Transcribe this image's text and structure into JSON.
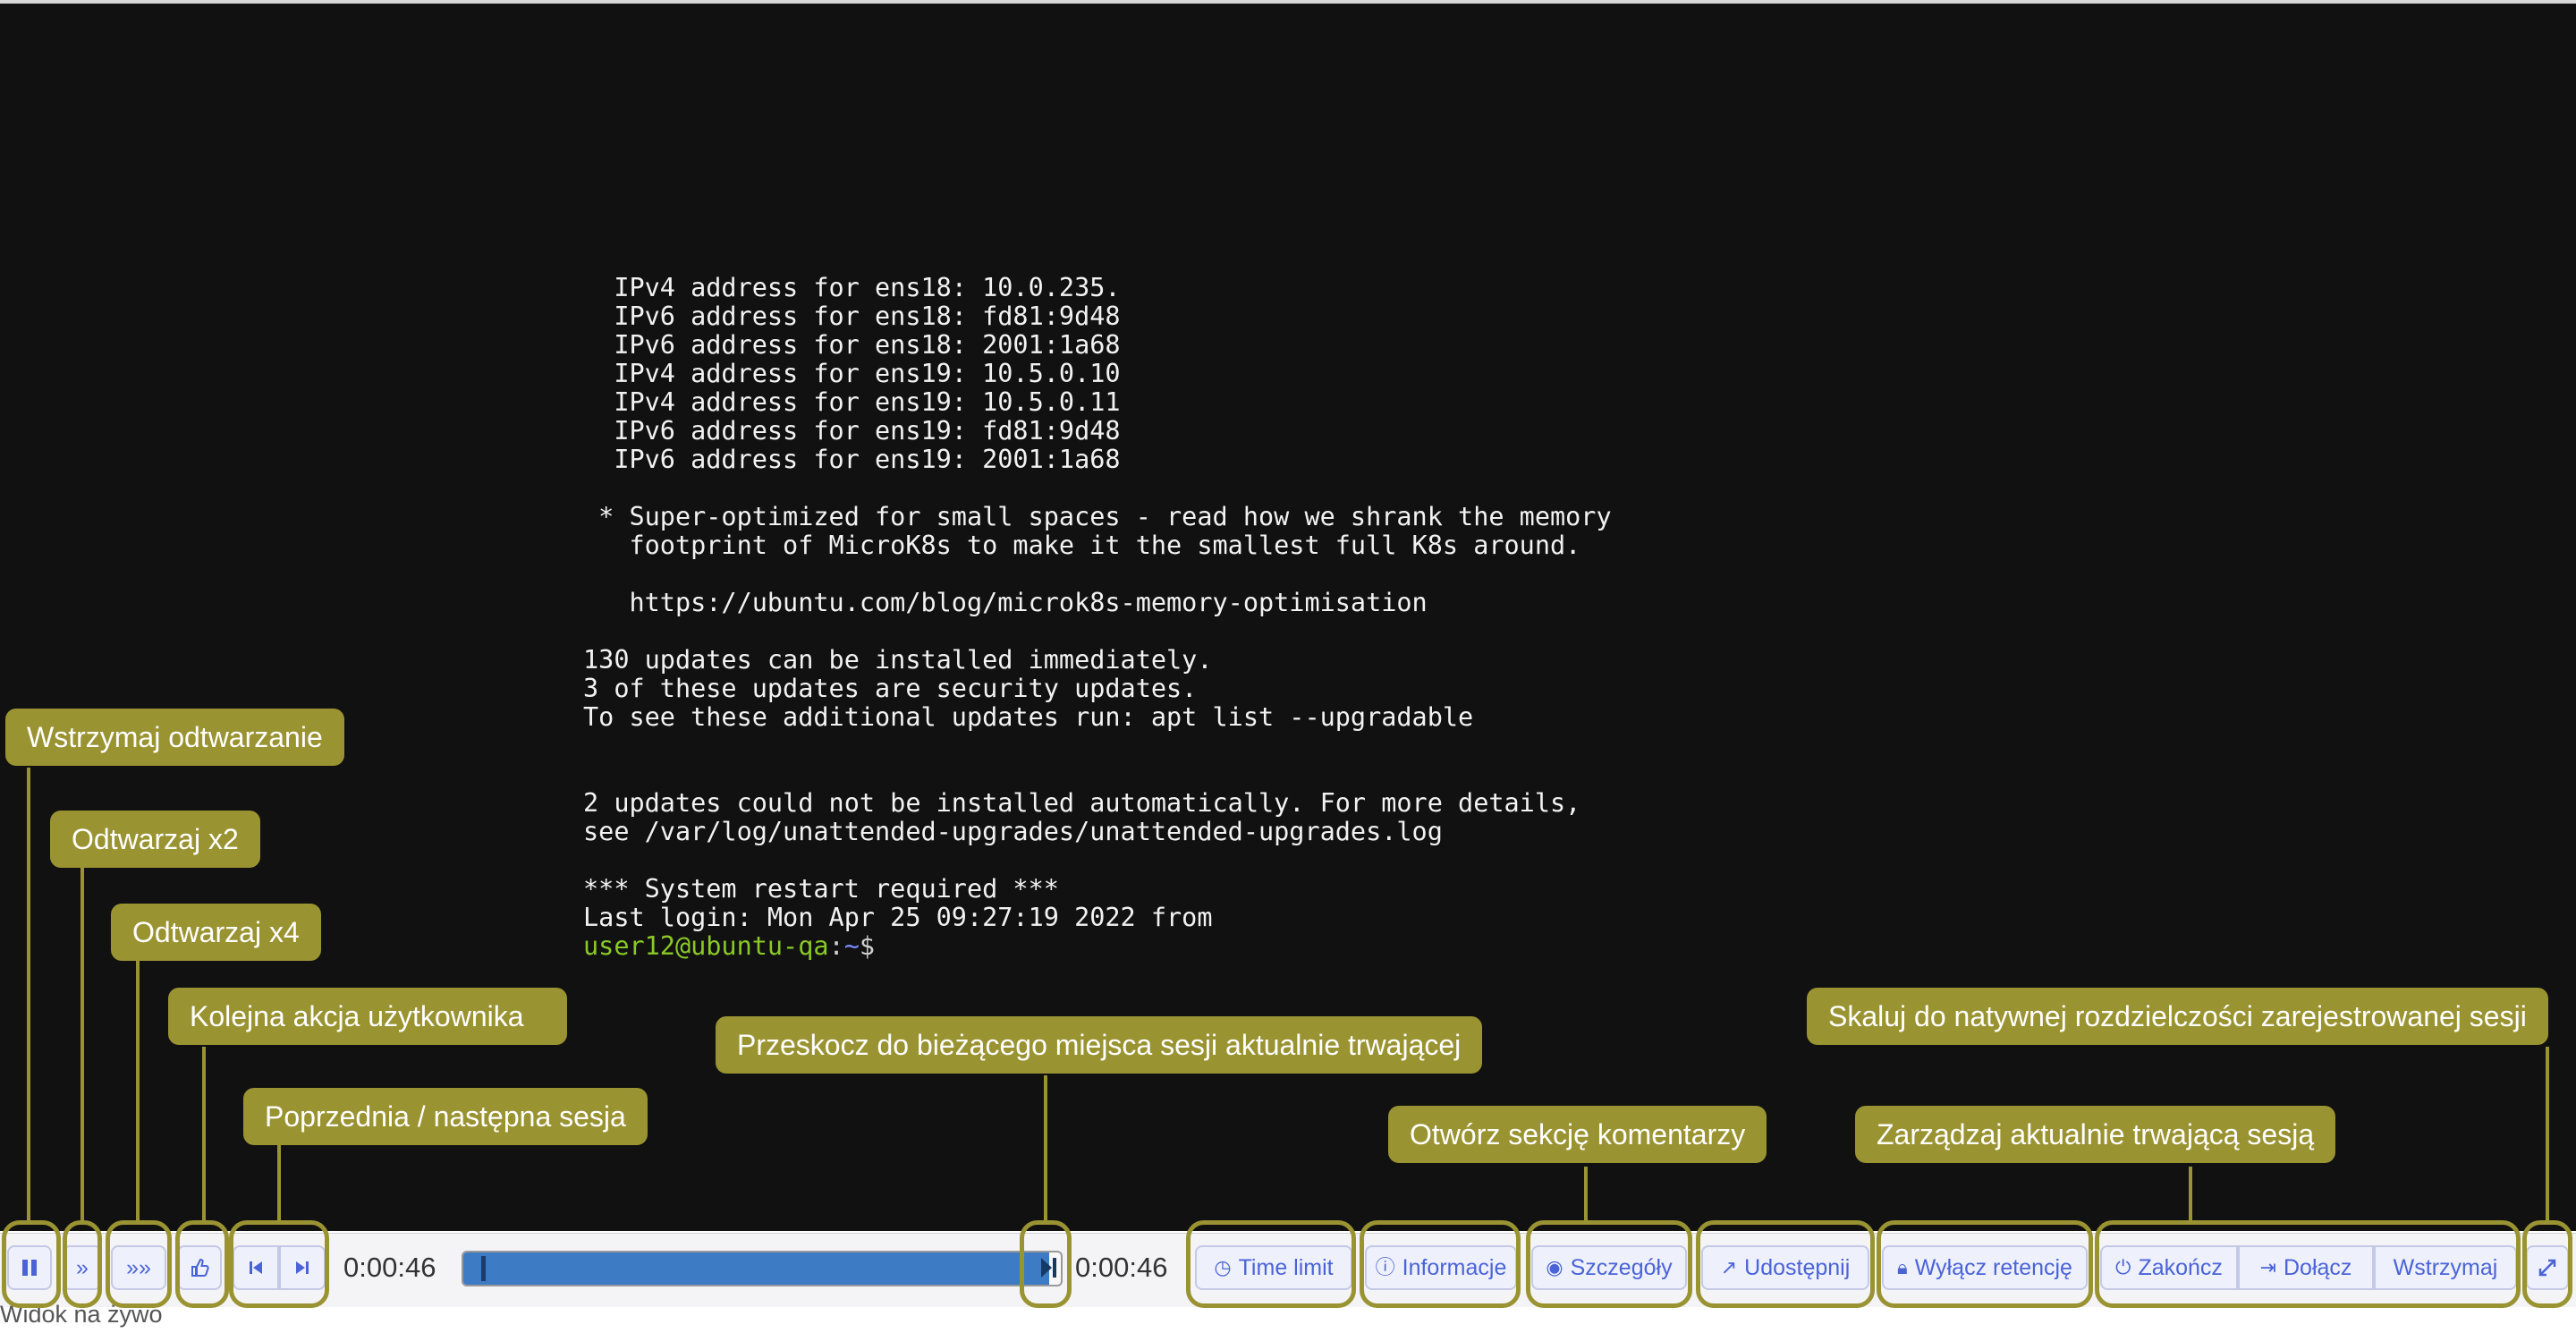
{
  "terminal": {
    "lines": [
      "  IPv4 address for ens18: 10.0.235.",
      "  IPv6 address for ens18: fd81:9d48",
      "  IPv6 address for ens18: 2001:1a68",
      "  IPv4 address for ens19: 10.5.0.10",
      "  IPv4 address for ens19: 10.5.0.11",
      "  IPv6 address for ens19: fd81:9d48",
      "  IPv6 address for ens19: 2001:1a68",
      "",
      " * Super-optimized for small spaces - read how we shrank the memory",
      "   footprint of MicroK8s to make it the smallest full K8s around.",
      "",
      "   https://ubuntu.com/blog/microk8s-memory-optimisation",
      "",
      "130 updates can be installed immediately.",
      "3 of these updates are security updates.",
      "To see these additional updates run: apt list --upgradable",
      "",
      "",
      "2 updates could not be installed automatically. For more details,",
      "see /var/log/unattended-upgrades/unattended-upgrades.log",
      "",
      "*** System restart required ***",
      "Last login: Mon Apr 25 09:27:19 2022 from"
    ],
    "prompt_user": "user12@ubuntu-qa",
    "prompt_colon": ":",
    "prompt_path": "~",
    "prompt_sign": "$"
  },
  "player": {
    "current_time": "0:00:46",
    "total_time": "0:00:46",
    "progress_fraction": 0.98,
    "live_label": "Widok na żywo"
  },
  "buttons": {
    "pause_icon": "pause-icon",
    "speed2": "»",
    "speed4": "»»",
    "next_action_icon": "hand-pointer-icon",
    "prev_icon": "step-backward-icon",
    "next_icon": "step-forward-icon",
    "time_limit": "Time limit",
    "informacje": "Informacje",
    "szczegoly": "Szczegóły",
    "udostepnij": "Udostępnij",
    "wylacz_retencje": "Wyłącz retencję",
    "zakoncz": "Zakończ",
    "dolacz": "Dołącz",
    "wstrzymaj": "Wstrzymaj",
    "fullscreen_icon": "expand-icon"
  },
  "tooltips": {
    "pause": "Wstrzymaj odtwarzanie",
    "speed2": "Odtwarzaj x2",
    "speed4": "Odtwarzaj x4",
    "next_action": "Kolejna akcja użytkownika",
    "prev_next": "Poprzednia / następna sesja",
    "jump_live": "Przeskocz do bieżącego miejsca sesji aktualnie trwającej",
    "comments": "Otwórz sekcję komentarzy",
    "manage_session": "Zarządzaj aktualnie trwającą sesją",
    "scale": "Skaluj do natywnej rozdzielczości zarejestrowanej sesji"
  },
  "colors": {
    "tooltip": "#9a9332",
    "button_text": "#4a64d8",
    "progress": "#3d7bc4",
    "terminal_bg": "#111111",
    "prompt_user": "#8ac926",
    "prompt_path": "#7b8cff"
  }
}
